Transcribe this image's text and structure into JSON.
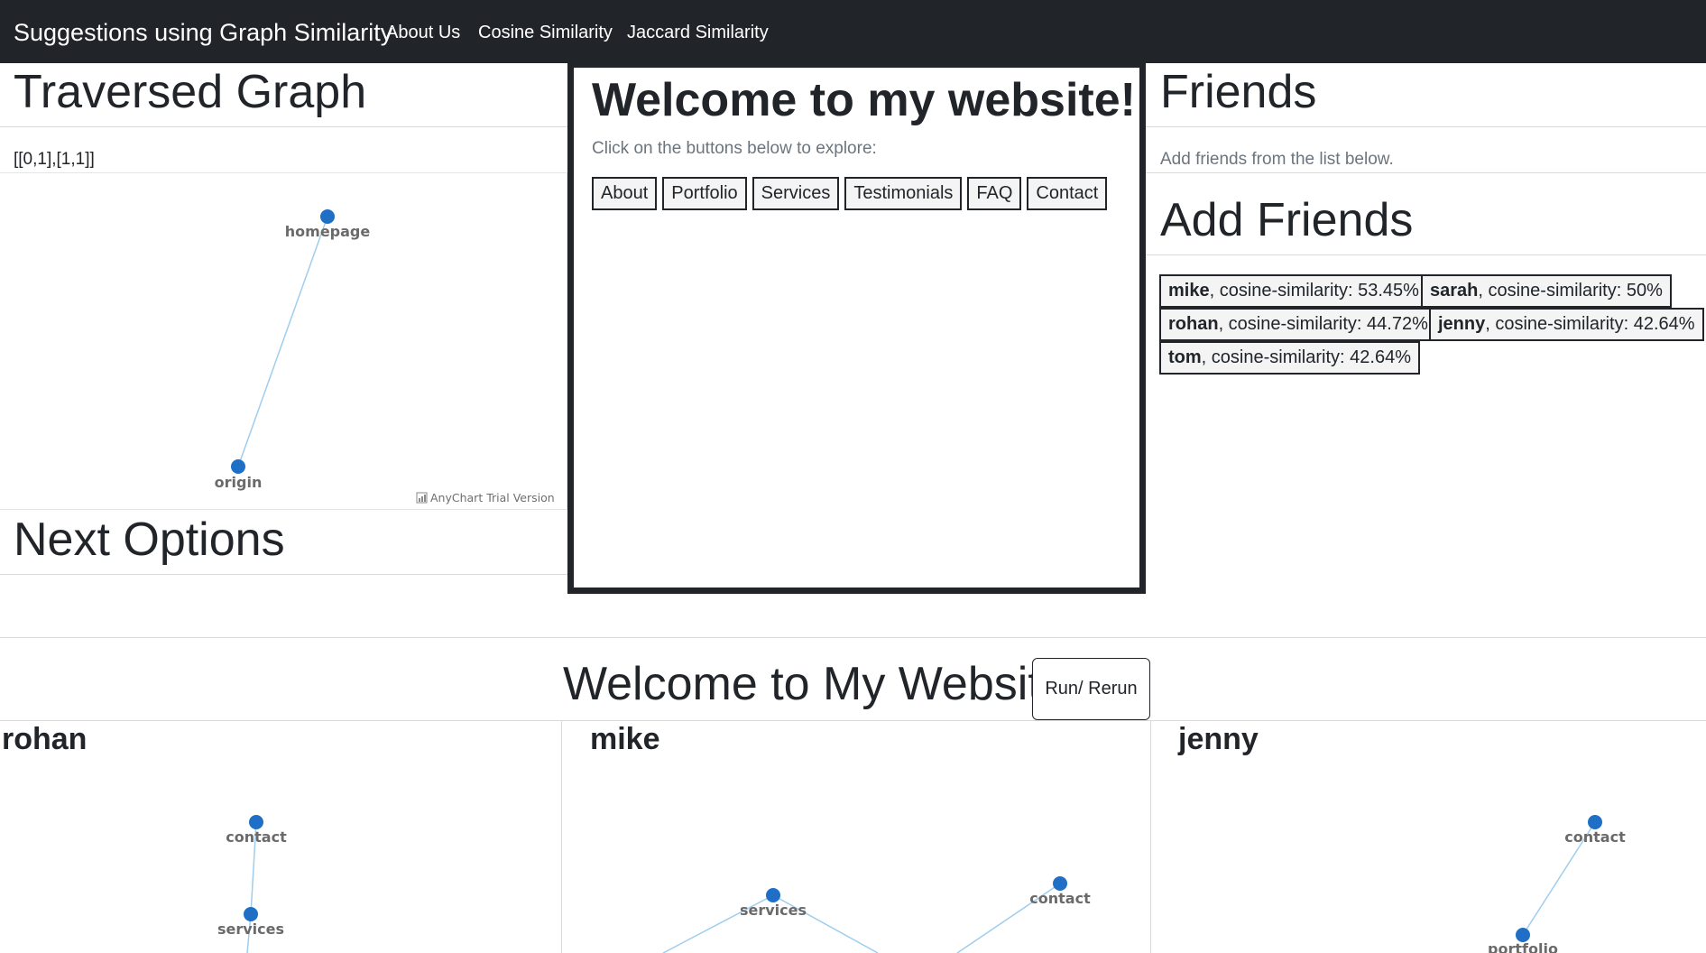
{
  "navbar": {
    "brand": "Suggestions using Graph Similarity",
    "links": [
      "About Us",
      "Cosine Similarity",
      "Jaccard Similarity"
    ]
  },
  "left": {
    "title": "Traversed Graph",
    "path_text": "[[0,1],[1,1]]",
    "graph": {
      "nodes": [
        "homepage",
        "origin"
      ],
      "watermark": "AnyChart Trial Version"
    },
    "next_title": "Next Options"
  },
  "modal": {
    "title": "Welcome to my website!",
    "subtitle": "Click on the buttons below to explore:",
    "buttons": [
      "About",
      "Portfolio",
      "Services",
      "Testimonials",
      "FAQ",
      "Contact"
    ]
  },
  "right": {
    "friends_title": "Friends",
    "friends_hint": "Add friends from the list below.",
    "add_title": "Add Friends",
    "suggestions": [
      {
        "name": "mike",
        "detail": ", cosine-similarity: 53.45%"
      },
      {
        "name": "sarah",
        "detail": ", cosine-similarity: 50%"
      },
      {
        "name": "rohan",
        "detail": ", cosine-similarity: 44.72%"
      },
      {
        "name": "jenny",
        "detail": ", cosine-similarity: 42.64%"
      },
      {
        "name": "tom",
        "detail": ", cosine-similarity: 42.64%"
      }
    ]
  },
  "bottom": {
    "welcome": "Welcome to My Website:",
    "run_button": "Run/ Rerun",
    "columns": [
      {
        "name": "rohan",
        "nodes": [
          "contact",
          "services"
        ]
      },
      {
        "name": "mike",
        "nodes": [
          "services",
          "contact"
        ]
      },
      {
        "name": "jenny",
        "nodes": [
          "contact",
          "portfolio"
        ]
      }
    ]
  },
  "colors": {
    "navbar_bg": "#212529",
    "node_fill": "#1f6fc7",
    "edge_stroke": "#9fcdee"
  }
}
